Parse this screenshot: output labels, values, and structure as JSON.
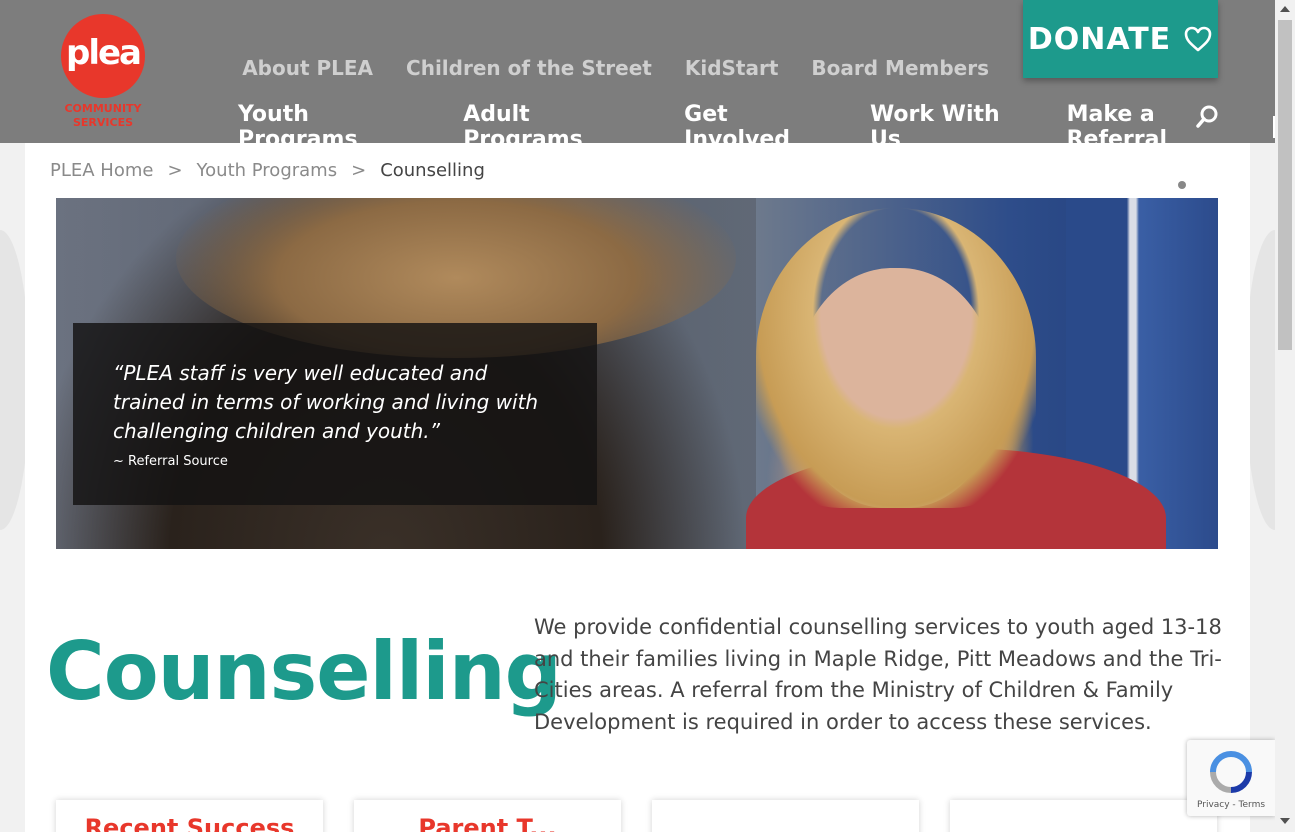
{
  "header": {
    "logo_word": "plea",
    "logo_sub": "COMMUNITY SERVICES",
    "top_nav": [
      "About PLEA",
      "Children of the Street",
      "KidStart",
      "Board Members"
    ],
    "main_nav": [
      "Youth Programs",
      "Adult Programs",
      "Get Involved",
      "Work With Us",
      "Make a Referral"
    ],
    "donate_label": "DONATE",
    "colors": {
      "header_bg": "#7d7d7d",
      "brand_red": "#e8372b",
      "teal": "#1d9a8c"
    }
  },
  "breadcrumb": {
    "items": [
      "PLEA Home",
      "Youth Programs",
      "Counselling"
    ],
    "separator": ">"
  },
  "hero": {
    "quote": "“PLEA staff is very well educated and trained in terms of working and living with challenging children and youth.”",
    "source": "~ Referral Source"
  },
  "main": {
    "title": "Counselling",
    "intro": "We provide confidential counselling services to youth aged 13-18 and their families living in Maple Ridge, Pitt Meadows and the Tri-Cities areas. A referral from the Ministry of Children & Family Development is required in order to access these services."
  },
  "cards": [
    "Recent Success",
    "Parent T...",
    "",
    ""
  ],
  "recaptcha": {
    "links": "Privacy - Terms"
  },
  "icons": [
    "heart-icon",
    "search-icon",
    "recaptcha-icon"
  ]
}
